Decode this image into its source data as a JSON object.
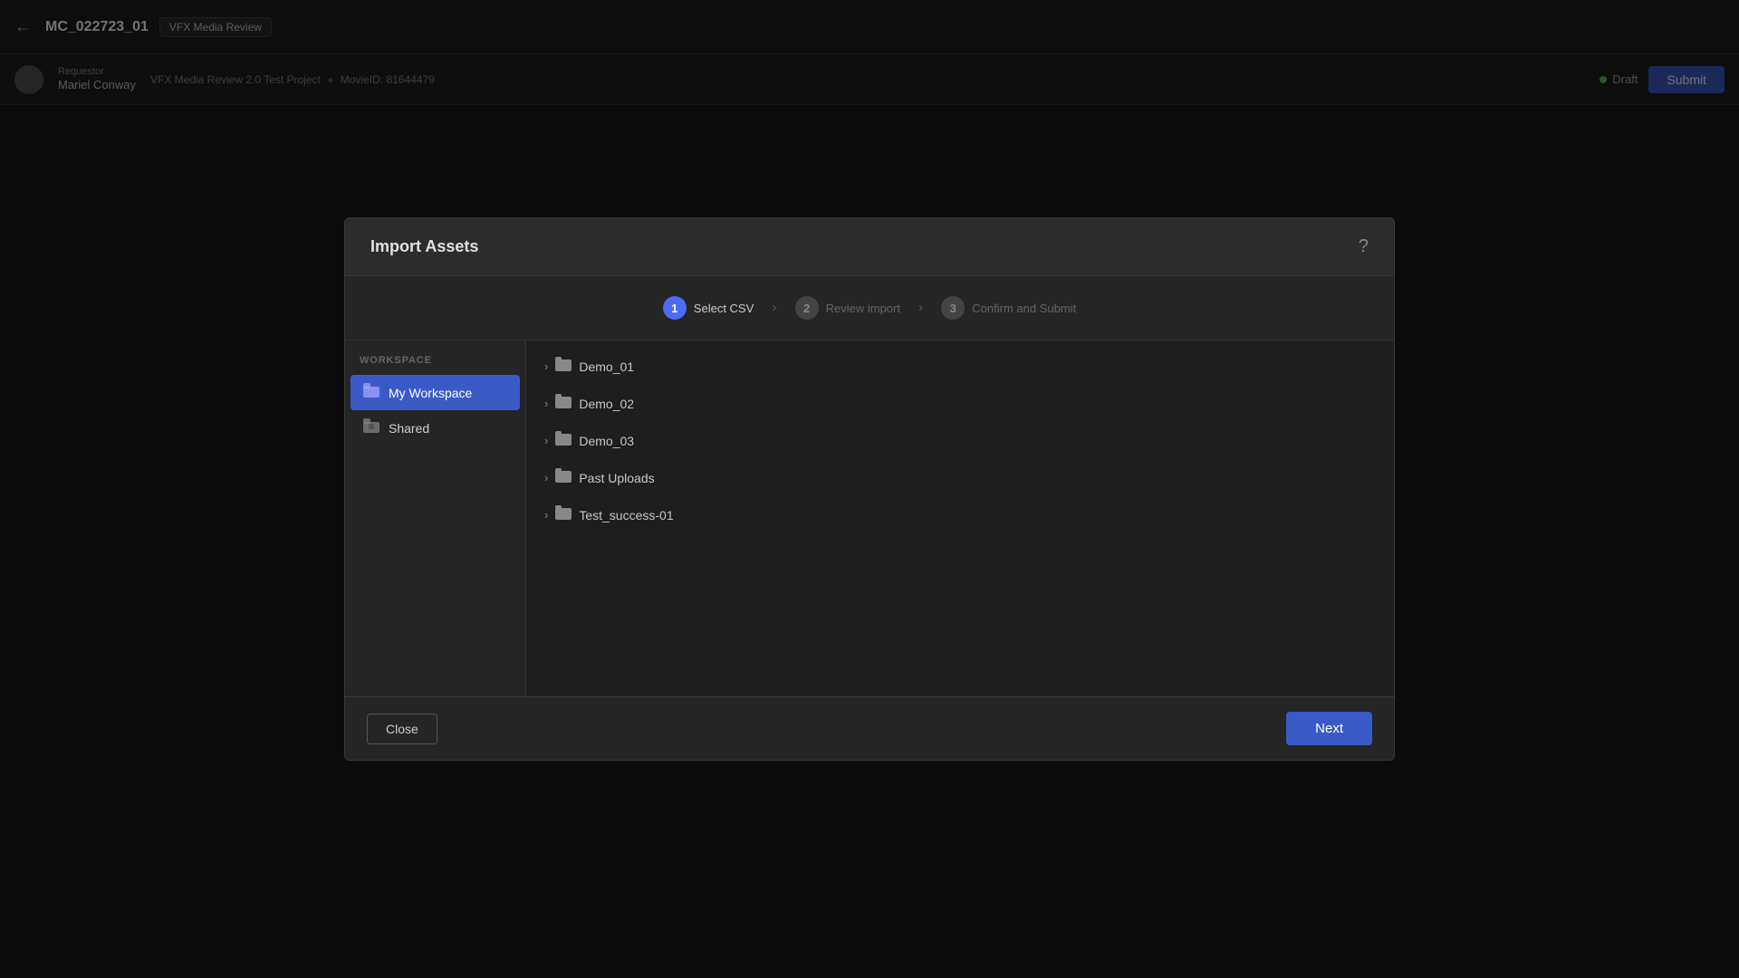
{
  "topbar": {
    "back_icon": "←",
    "project_id": "MC_022723_01",
    "badge_label": "VFX Media Review",
    "help_icon": "?",
    "sub_info_text": "VFX Media Review 2.0 Test Project",
    "dot": "●",
    "movie_id_label": "MovieID: 81644479",
    "requester_label": "Requestor",
    "requester_name": "Mariel Conway",
    "draft_label": "Draft",
    "submit_label": "Submit"
  },
  "modal": {
    "title": "Import Assets",
    "help_icon": "?",
    "steps": [
      {
        "num": "1",
        "label": "Select CSV",
        "active": true
      },
      {
        "num": "2",
        "label": "Review import",
        "active": false
      },
      {
        "num": "3",
        "label": "Confirm and Submit",
        "active": false
      }
    ],
    "sidebar": {
      "section_label": "WORKSPACE",
      "items": [
        {
          "label": "My Workspace",
          "icon": "📁",
          "active": true
        },
        {
          "label": "Shared",
          "icon": "🗂",
          "active": false
        }
      ]
    },
    "folders": [
      {
        "name": "Demo_01"
      },
      {
        "name": "Demo_02"
      },
      {
        "name": "Demo_03"
      },
      {
        "name": "Past Uploads"
      },
      {
        "name": "Test_success-01"
      }
    ],
    "footer": {
      "close_label": "Close",
      "next_label": "Next"
    }
  }
}
